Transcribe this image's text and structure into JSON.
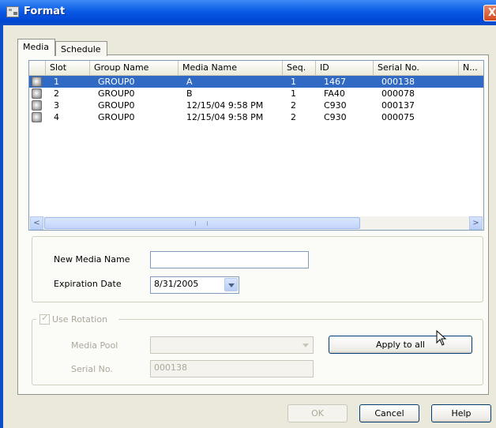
{
  "window": {
    "title": "Format",
    "close_glyph": "X"
  },
  "tabs": {
    "media": "Media",
    "schedule": "Schedule"
  },
  "list": {
    "columns": [
      "Slot",
      "Group Name",
      "Media Name",
      "Seq.",
      "ID",
      "Serial No.",
      "N..."
    ],
    "rows": [
      {
        "slot": "1",
        "group": "GROUP0",
        "media": "A",
        "seq": "1",
        "id": "1467",
        "serial": "000138",
        "selected": true
      },
      {
        "slot": "2",
        "group": "GROUP0",
        "media": "B",
        "seq": "1",
        "id": "FA40",
        "serial": "000078",
        "selected": false
      },
      {
        "slot": "3",
        "group": "GROUP0",
        "media": "12/15/04 9:58 PM",
        "seq": "2",
        "id": "C930",
        "serial": "000137",
        "selected": false
      },
      {
        "slot": "4",
        "group": "GROUP0",
        "media": "12/15/04 9:58 PM",
        "seq": "2",
        "id": "C930",
        "serial": "000075",
        "selected": false
      }
    ],
    "scroll_left": "<",
    "scroll_right": ">"
  },
  "form": {
    "new_media_label": "New Media Name",
    "new_media_value": "",
    "expiration_label": "Expiration  Date",
    "expiration_value": "8/31/2005"
  },
  "rotation": {
    "checkbox_label": "Use Rotation",
    "checkbox_checked": true,
    "media_pool_label": "Media Pool",
    "media_pool_value": "",
    "serial_label": "Serial No.",
    "serial_value": "000138",
    "apply_all_label": "Apply to all"
  },
  "buttons": {
    "ok": "OK",
    "cancel": "Cancel",
    "help": "Help"
  },
  "colors": {
    "titlebar": "#0a5ae6",
    "selection": "#316ac5",
    "dialog_bg": "#ebe9db"
  }
}
